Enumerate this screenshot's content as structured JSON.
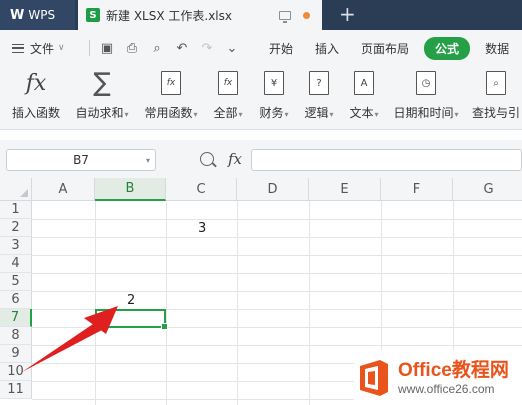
{
  "titlebar": {
    "app_name": "WPS",
    "doc_badge": "S",
    "doc_title": "新建 XLSX 工作表.xlsx",
    "new_tab": "+"
  },
  "menubar": {
    "file_label": "文件",
    "tabs": [
      {
        "label": "开始",
        "active": false
      },
      {
        "label": "插入",
        "active": false
      },
      {
        "label": "页面布局",
        "active": false
      },
      {
        "label": "公式",
        "active": true
      },
      {
        "label": "数据",
        "active": false
      }
    ]
  },
  "ribbon": {
    "buttons": [
      {
        "label": "插入函数",
        "icon": "fx-icon",
        "glyph": "fx",
        "dropdown": false
      },
      {
        "label": "自动求和",
        "icon": "sigma-icon",
        "glyph": "∑",
        "dropdown": true
      },
      {
        "label": "常用函数",
        "icon": "favorite-function-icon",
        "glyph": "fx",
        "dropdown": true
      },
      {
        "label": "全部",
        "icon": "all-functions-icon",
        "glyph": "fx",
        "dropdown": true
      },
      {
        "label": "财务",
        "icon": "finance-icon",
        "glyph": "¥",
        "dropdown": true
      },
      {
        "label": "逻辑",
        "icon": "logic-icon",
        "glyph": "?",
        "dropdown": true
      },
      {
        "label": "文本",
        "icon": "text-icon",
        "glyph": "A",
        "dropdown": true
      },
      {
        "label": "日期和时间",
        "icon": "datetime-icon",
        "glyph": "◷",
        "dropdown": true
      },
      {
        "label": "查找与引",
        "icon": "lookup-icon",
        "glyph": "⌕",
        "dropdown": false
      }
    ]
  },
  "formula_bar": {
    "name_box": "B7",
    "fx_label": "fx",
    "formula": ""
  },
  "sheet": {
    "columns": [
      "A",
      "B",
      "C",
      "D",
      "E",
      "F",
      "G"
    ],
    "rows": [
      "1",
      "2",
      "3",
      "4",
      "5",
      "6",
      "7",
      "8",
      "9",
      "10",
      "11"
    ],
    "selected_column": "B",
    "selected_row": "7",
    "cells": {
      "C2": "3",
      "B6": "2"
    }
  },
  "watermark": {
    "title": "Office教程网",
    "url": "www.office26.com"
  },
  "colors": {
    "accent_green": "#25a046",
    "titlebar_bg": "#2b3d55",
    "annotation_red": "#e02020",
    "watermark_orange": "#e8541c"
  }
}
